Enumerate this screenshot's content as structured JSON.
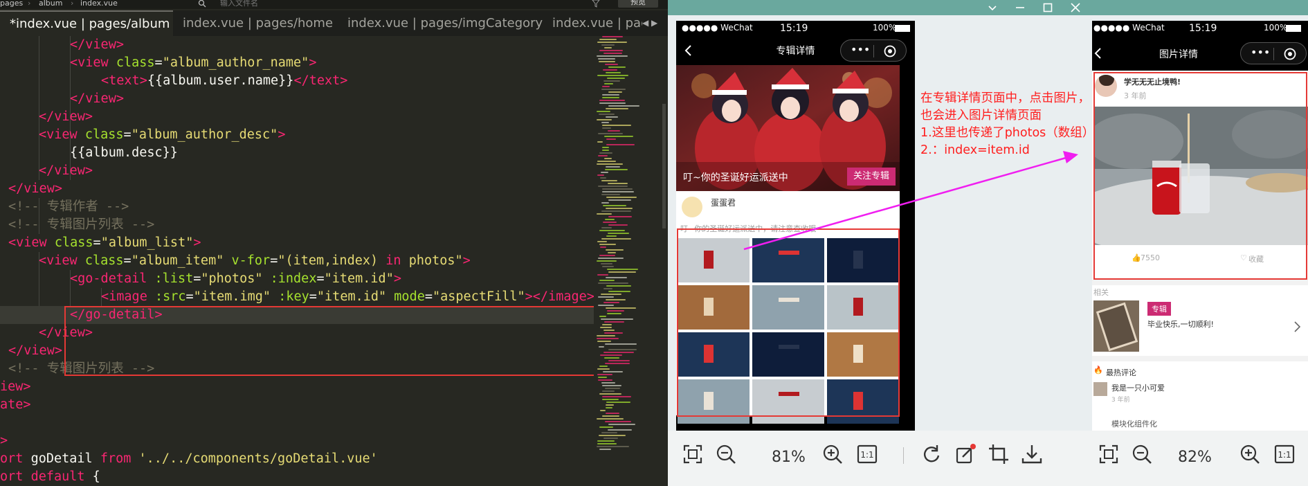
{
  "topbar": {
    "crumbs": [
      "pages",
      "album",
      "index.vue"
    ],
    "search_placeholder": "输入文件名",
    "preview_label": "预览"
  },
  "tabs": [
    {
      "label": "*index.vue | pages/album",
      "active": true
    },
    {
      "label": "index.vue | pages/home",
      "active": false
    },
    {
      "label": "index.vue | pages/imgCategory",
      "active": false
    },
    {
      "label": "index.vue | pag",
      "active": false
    }
  ],
  "tab_arrows": "◀ ▶",
  "code": {
    "l1": "</view>",
    "l2_open": "<view",
    "l2_attr": "class",
    "l2_val": "\"album_author_name\"",
    "l3_open": "<text>",
    "l3_expr": "{{album.user.name}}",
    "l3_close": "</text>",
    "l4": "</view>",
    "l5": "</view>",
    "l6_open": "<view",
    "l6_attr": "class",
    "l6_val": "\"album_author_desc\"",
    "l7": "{{album.desc}}",
    "l8": "</view>",
    "l9": "</view>",
    "l10": "<!-- 专辑作者 -->",
    "l11": "<!-- 专辑图片列表 -->",
    "l12_open": "<view",
    "l12_attr": "class",
    "l12_val": "\"album_list\"",
    "l13_open": "<view",
    "l13_attr1": "class",
    "l13_val1": "\"album_item\"",
    "l13_attr2": "v-for",
    "l13_val2": "\"(item,index)",
    "l13_in": "in",
    "l13_val3": "photos\"",
    "l14_open": "<go-detail",
    "l14_attr1": ":list",
    "l14_val1": "\"photos\"",
    "l14_attr2": ":index",
    "l14_val2": "\"item.id\"",
    "l15_open": "<image",
    "l15_attr1": ":src",
    "l15_val1": "\"item.img\"",
    "l15_attr2": ":key",
    "l15_val2": "\"item.id\"",
    "l15_attr3": "mode",
    "l15_val3": "\"aspectFill\"",
    "l15_close": "</image>",
    "l16": "</go-detail>",
    "l17": "</view>",
    "l18": "</view>",
    "l19": "<!-- 专辑图片列表 -->",
    "l20": "iew>",
    "l21": "ate>",
    "l22": ">",
    "l23_kw": "ort",
    "l23_name": "goDetail",
    "l23_from": "from",
    "l23_path": "'../../components/goDetail.vue'",
    "l24_kw": "ort",
    "l24_def": "default",
    "l24_brace": "{"
  },
  "phone1": {
    "status_left": "●●●●● WeChat",
    "status_time": "15:19",
    "status_battery": "100%",
    "nav_title": "专辑详情",
    "banner_text": "叮~你的圣诞好运派送中",
    "follow_label": "关注专辑",
    "author_name": "蛋蛋君",
    "author_desc": "叮~你的圣诞好运派送中，请注意查收哦~"
  },
  "viewer1": {
    "zoom": "81%"
  },
  "annotation": {
    "line1": "在专辑详情页面中，点击图片，",
    "line2": "也会进入图片详情页面",
    "line3": "1.这里也传递了photos（数组）",
    "line4": "2.：index=item.id"
  },
  "phone2": {
    "status_left": "●●●●● WeChat",
    "status_time": "15:19",
    "status_battery": "100%",
    "nav_title": "图片详情",
    "user_name": "学无无无止境鸭!",
    "post_time": "3 年前",
    "likes": "7550",
    "fav_label": "收藏",
    "related_label": "相关",
    "album_tag": "专辑",
    "album_desc": "毕业快乐,一切顺利!",
    "hot_comment_label": "最热评论",
    "commenter": "我是一只小可爱",
    "comment_time": "3 年前",
    "comment_text": "模块化组件化"
  },
  "viewer2": {
    "zoom": "82%"
  },
  "colors": {
    "editor_bg": "#272822",
    "tag": "#f92672",
    "attr": "#a6e22e",
    "string": "#e6db74",
    "comment": "#75715e",
    "highlight_red": "#e53935",
    "annotation_red": "#ff1e1e",
    "arrow_magenta": "#f01ef0",
    "titlebar_teal": "#6aa89e",
    "accent_pink": "#cc2b73"
  }
}
